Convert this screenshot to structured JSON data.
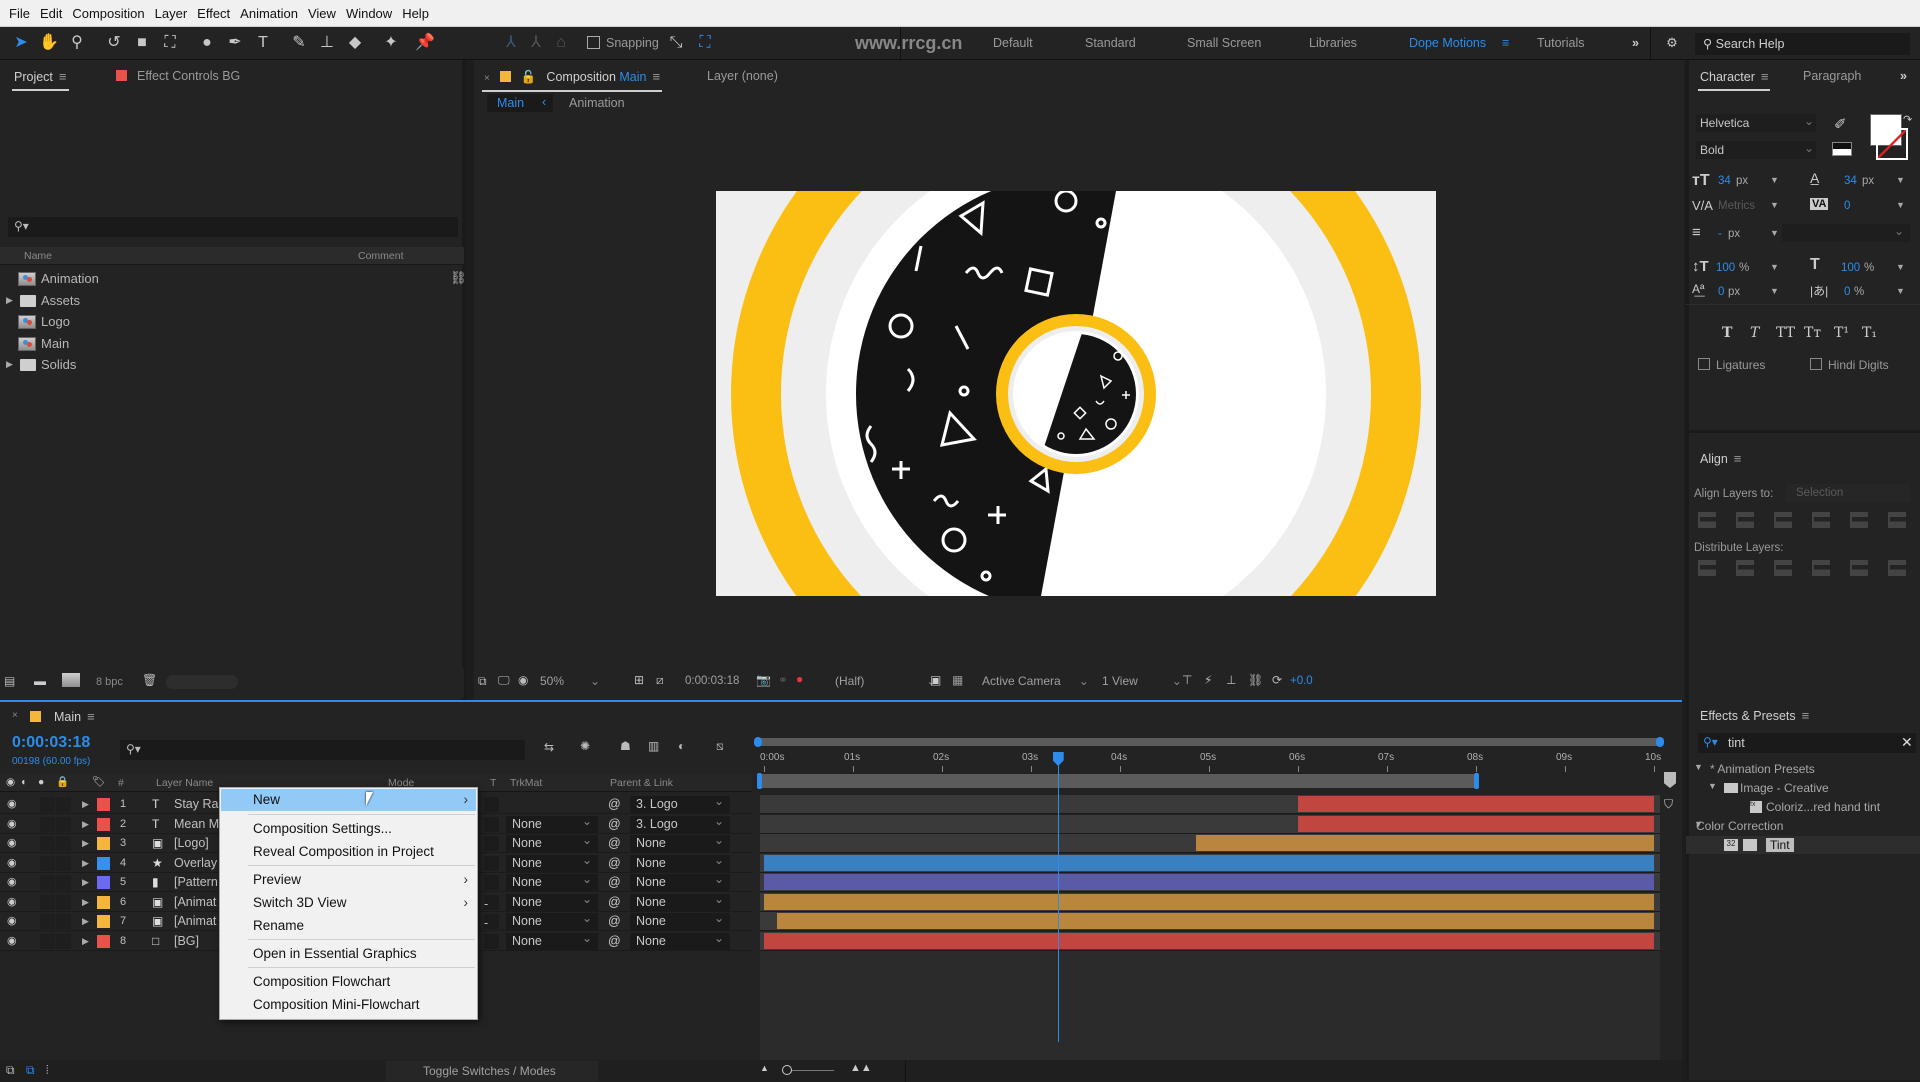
{
  "menubar": [
    "File",
    "Edit",
    "Composition",
    "Layer",
    "Effect",
    "Animation",
    "View",
    "Window",
    "Help"
  ],
  "toolbar": {
    "snapping_label": "Snapping",
    "snapping_checked": false,
    "workspaces": [
      "Default",
      "Standard",
      "Small Screen",
      "Libraries",
      "Dope Motions",
      "Tutorials"
    ],
    "active_workspace": "Dope Motions",
    "search_help_placeholder": "Search Help",
    "watermark": "www.rrcg.cn"
  },
  "project_panel": {
    "tabs": [
      "Project",
      "Effect Controls BG"
    ],
    "columns": [
      "Name",
      "Comment"
    ],
    "items": [
      {
        "name": "Animation",
        "type": "composition"
      },
      {
        "name": "Assets",
        "type": "folder"
      },
      {
        "name": "Logo",
        "type": "composition"
      },
      {
        "name": "Main",
        "type": "composition"
      },
      {
        "name": "Solids",
        "type": "folder"
      }
    ],
    "bpc": "8 bpc"
  },
  "composition_panel": {
    "tab_prefix": "Composition",
    "tab_comp": "Main",
    "layer_tab": "Layer  (none)",
    "breadcrumbs": [
      "Main",
      "Animation"
    ],
    "footer": {
      "zoom": "50%",
      "timecode": "0:00:03:18",
      "resolution": "(Half)",
      "camera": "Active Camera",
      "views": "1 View",
      "exposure": "+0.0"
    }
  },
  "character_panel": {
    "tabs": [
      "Character",
      "Paragraph"
    ],
    "font": "Helvetica",
    "style": "Bold",
    "font_size": "34",
    "leading": "34",
    "kerning": "Metrics",
    "tracking": "0",
    "stroke_width": "-",
    "vertical_scale": "100",
    "horizontal_scale": "100",
    "baseline_shift": "0",
    "tsume": "0",
    "unit_px": "px",
    "unit_pct": "%",
    "style_buttons": [
      "T",
      "T",
      "TT",
      "Tт",
      "T¹",
      "T₁"
    ],
    "ligatures_label": "Ligatures",
    "hindi_digits_label": "Hindi Digits"
  },
  "align_panel": {
    "title": "Align",
    "align_to_label": "Align Layers to:",
    "align_to_value": "Selection",
    "distribute_label": "Distribute Layers:"
  },
  "timeline": {
    "comp_name": "Main",
    "timecode": "0:00:03:18",
    "frame_info": "00198 (60.00 fps)",
    "columns": {
      "num": "#",
      "name": "Layer Name",
      "mode": "Mode",
      "t": "T",
      "trkmat": "TrkMat",
      "parent": "Parent & Link"
    },
    "ruler": [
      "0:00s",
      "01s",
      "02s",
      "03s",
      "04s",
      "05s",
      "06s",
      "07s",
      "08s",
      "09s",
      "10s"
    ],
    "duration_seconds": 10,
    "current_time_seconds": 3.3,
    "work_area_end_seconds": 8.0,
    "layers": [
      {
        "num": "1",
        "type": "text",
        "name": "Stay Ra",
        "label_color": "#e8524a",
        "trkmat": "",
        "parent": "3. Logo",
        "t_switch": "",
        "bar_color": "#c0463f",
        "start": 6.0,
        "end": 10.0
      },
      {
        "num": "2",
        "type": "text",
        "name": "Mean M",
        "label_color": "#e8524a",
        "trkmat": "None",
        "parent": "3. Logo",
        "t_switch": "",
        "bar_color": "#c0463f",
        "start": 6.0,
        "end": 10.0
      },
      {
        "num": "3",
        "type": "precomp",
        "name": "[Logo]",
        "label_color": "#f5b73b",
        "trkmat": "None",
        "parent": "None",
        "t_switch": "",
        "bar_color": "#b8863d",
        "start": 4.85,
        "end": 10.0
      },
      {
        "num": "4",
        "type": "shape",
        "name": "Overlay",
        "label_color": "#3a8fe8",
        "trkmat": "None",
        "parent": "None",
        "t_switch": "",
        "bar_color": "#3a7fc0",
        "start": 0.0,
        "end": 10.0
      },
      {
        "num": "5",
        "type": "image",
        "name": "[Pattern",
        "label_color": "#6b6bf0",
        "trkmat": "None",
        "parent": "None",
        "t_switch": "",
        "bar_color": "#5a5aa8",
        "start": 0.0,
        "end": 10.0
      },
      {
        "num": "6",
        "type": "precomp",
        "name": "[Animat",
        "label_color": "#f5b73b",
        "trkmat": "None",
        "parent": "None",
        "t_switch": "-",
        "bar_color": "#b8863d",
        "start": 0.0,
        "end": 10.0
      },
      {
        "num": "7",
        "type": "precomp",
        "name": "[Animat",
        "label_color": "#f5b73b",
        "trkmat": "None",
        "parent": "None",
        "t_switch": "-",
        "bar_color": "#b8863d",
        "start": 0.15,
        "end": 10.0
      },
      {
        "num": "8",
        "type": "solid",
        "name": "[BG]",
        "label_color": "#e8524a",
        "trkmat": "None",
        "parent": "None",
        "t_switch": "",
        "bar_color": "#c0463f",
        "start": 0.0,
        "end": 10.0
      }
    ],
    "footer_toggle": "Toggle Switches / Modes"
  },
  "context_menu": {
    "items": [
      {
        "label": "New",
        "submenu": true,
        "highlighted": true
      },
      {
        "label": "Composition Settings...",
        "submenu": false
      },
      {
        "label": "Reveal Composition in Project",
        "submenu": false
      },
      {
        "label": "Preview",
        "submenu": true
      },
      {
        "label": "Switch 3D View",
        "submenu": true
      },
      {
        "label": "Rename",
        "submenu": false
      },
      {
        "label": "Open in Essential Graphics",
        "submenu": false
      },
      {
        "label": "Composition Flowchart",
        "submenu": false
      },
      {
        "label": "Composition Mini-Flowchart",
        "submenu": false
      }
    ]
  },
  "effects_panel": {
    "title": "Effects & Presets",
    "search_value": "tint",
    "tree": [
      {
        "label": "* Animation Presets",
        "level": 0
      },
      {
        "label": "Image - Creative",
        "level": 1
      },
      {
        "label": "Coloriz...red hand tint",
        "level": 2
      },
      {
        "label": "Color Correction",
        "level": 0
      },
      {
        "label": "Tint",
        "level": 1,
        "selected": true
      }
    ]
  },
  "colors": {
    "accent": "#2d8ceb",
    "yellow": "#fbbf14",
    "black": "#141414"
  }
}
